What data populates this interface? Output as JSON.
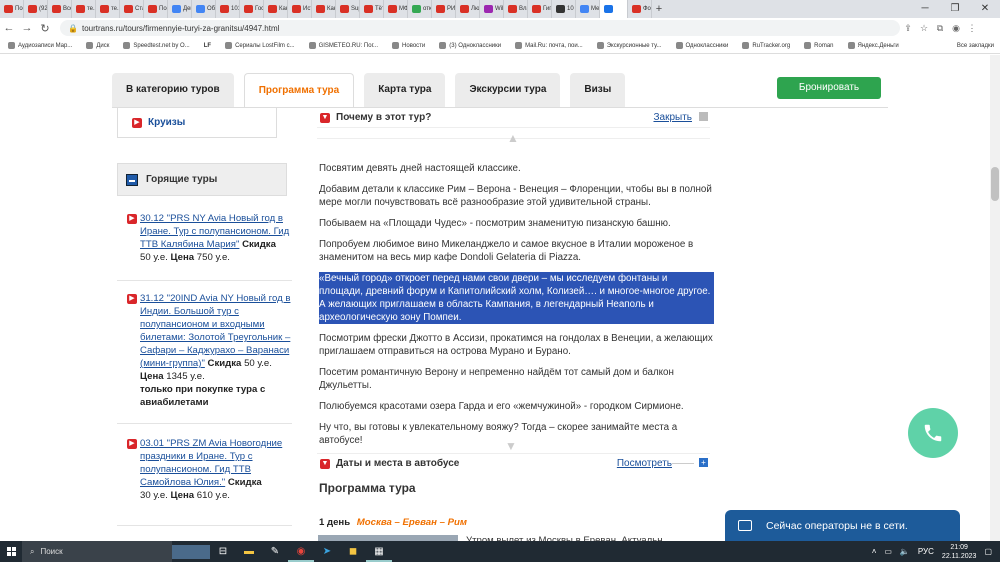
{
  "browser": {
    "tabs": [
      {
        "label": "Пос",
        "color": "#d93025"
      },
      {
        "label": "(92)",
        "color": "#d93025"
      },
      {
        "label": "Все",
        "color": "#d93025"
      },
      {
        "label": "те.1",
        "color": "#d93025"
      },
      {
        "label": "те.К",
        "color": "#d93025"
      },
      {
        "label": "Ста",
        "color": "#d93025"
      },
      {
        "label": "Пос",
        "color": "#d93025"
      },
      {
        "label": "Дев",
        "color": "#4285f4"
      },
      {
        "label": "Обз",
        "color": "#4285f4"
      },
      {
        "label": "101",
        "color": "#d93025"
      },
      {
        "label": "Гос",
        "color": "#d93025"
      },
      {
        "label": "Как",
        "color": "#d93025"
      },
      {
        "label": "Ист",
        "color": "#d93025"
      },
      {
        "label": "Как",
        "color": "#d93025"
      },
      {
        "label": "Sup",
        "color": "#d93025"
      },
      {
        "label": "Тёт",
        "color": "#d93025"
      },
      {
        "label": "МФ",
        "color": "#d93025"
      },
      {
        "label": "отк",
        "color": "#34a853"
      },
      {
        "label": "РИ",
        "color": "#d93025"
      },
      {
        "label": "Лю",
        "color": "#d93025"
      },
      {
        "label": "Wil",
        "color": "#9c27b0"
      },
      {
        "label": "Вла",
        "color": "#d93025"
      },
      {
        "label": "Гиг",
        "color": "#d93025"
      },
      {
        "label": "10 ·",
        "color": "#333333"
      },
      {
        "label": "Ме",
        "color": "#4285f4"
      },
      {
        "label": "",
        "color": "#1a73e8",
        "active": true
      },
      {
        "label": "Фо",
        "color": "#d93025"
      }
    ],
    "new_tab": "+",
    "url": "tourtrans.ru/tours/firmennyie-turyi-za-granitsu/4947.html",
    "bookmarks": [
      "Аудиозаписи Мар...",
      "Диск",
      "Speedtest.net by O...",
      "Сериалы LostFilm с...",
      "GISMETEO.RU: Пог...",
      "Новости",
      "(3) Одноклассники",
      "Mail.Ru: почта, пои...",
      "Экскурсионные ту...",
      "Одноклассники",
      "RuTracker.org",
      "Roman",
      "Яндекс.Деньги"
    ],
    "bookmarks_lf": "LF",
    "all_bookmarks": "Все закладки"
  },
  "nav": {
    "tabs": [
      "В категорию туров",
      "Программа тура",
      "Карта тура",
      "Экскурсии тура",
      "Визы"
    ],
    "active_index": 1,
    "book_button": "Бронировать"
  },
  "sidebar": {
    "cruises": "Круизы",
    "hot_title": "Горящие туры",
    "tours": [
      {
        "link": "30.12 \"PRS NY Avia Новый год в Иране. Тур с полупансионом. Гид ТТВ Калябина Мария\"",
        "discount_label": "Скидка",
        "discount": "50 у.е.",
        "price_label": "Цена",
        "price": "750 у.е.",
        "note": ""
      },
      {
        "link": "31.12 \"20IND Avia NY Новый год в Индии. Большой тур с полупансионом и входными билетами: Золотой Треугольник – Сафари – Каджурахо – Варанаси (мини-группа)\"",
        "discount_label": "Скидка",
        "discount": "50 у.е.",
        "price_label": "Цена",
        "price": "1345 у.е.",
        "note": "только при покупке тура с авиабилетами"
      },
      {
        "link": "03.01 \"PRS ZM Avia Новогодние праздники в Иране. Тур с полупансионом. Гид ТТВ Самойлова Юлия.\"",
        "discount_label": "Скидка",
        "discount": "30 у.е.",
        "price_label": "Цена",
        "price": "610 у.е.",
        "note": ""
      }
    ]
  },
  "why": {
    "title": "Почему в этот тур?",
    "close": "Закрыть",
    "paragraphs": [
      "Посвятим девять дней настоящей классике.",
      "Добавим детали к классике Рим – Верона - Венеция – Флоренции, чтобы вы в полной мере могли почувствовать всё разнообразие этой удивительной страны.",
      "Побываем на «Площади Чудес» - посмотрим знаменитую пизанскую башню.",
      "Попробуем любимое вино Микеланджело и самое вкусное в Италии мороженое в знаменитом на весь мир кафе Dondoli Gelateria di Piazza.",
      "«Вечный город» откроет перед нами свои двери – мы исследуем фонтаны и площади, древний форум и Капитолийский холм, Колизей…. и многое-многое другое. А желающих приглашаем в область Кампания, в легендарный Неаполь и археологическую зону Помпеи.",
      "Посмотрим фрески Джотто в Ассизи, прокатимся на гондолах в Венеции, а желающих приглашаем отправиться на острова Мурано и Бурано.",
      "Посетим романтичную Верону и непременно найдём тот самый дом и балкон Джульетты.",
      "Полюбуемся красотами озера Гарда и его «жемчужиной» - городком Сирмионе.",
      "Ну что, вы готовы к увлекательному вояжу? Тогда – скорее занимайте места а автобусе!"
    ],
    "selected_index": 4
  },
  "dates": {
    "title": "Даты и места в автобусе",
    "view": "Посмотреть"
  },
  "program": {
    "title": "Программа тура",
    "day1_label": "1 день",
    "day1_route": "Москва – Ереван – Рим",
    "day1_text": "Утром вылет из Москвы в Ереван. Актуальн..."
  },
  "chat": {
    "status": "Сейчас операторы не в сети."
  },
  "taskbar": {
    "search": "Поиск",
    "lang": "РУС",
    "time": "21:09",
    "date": "22.11.2023"
  }
}
